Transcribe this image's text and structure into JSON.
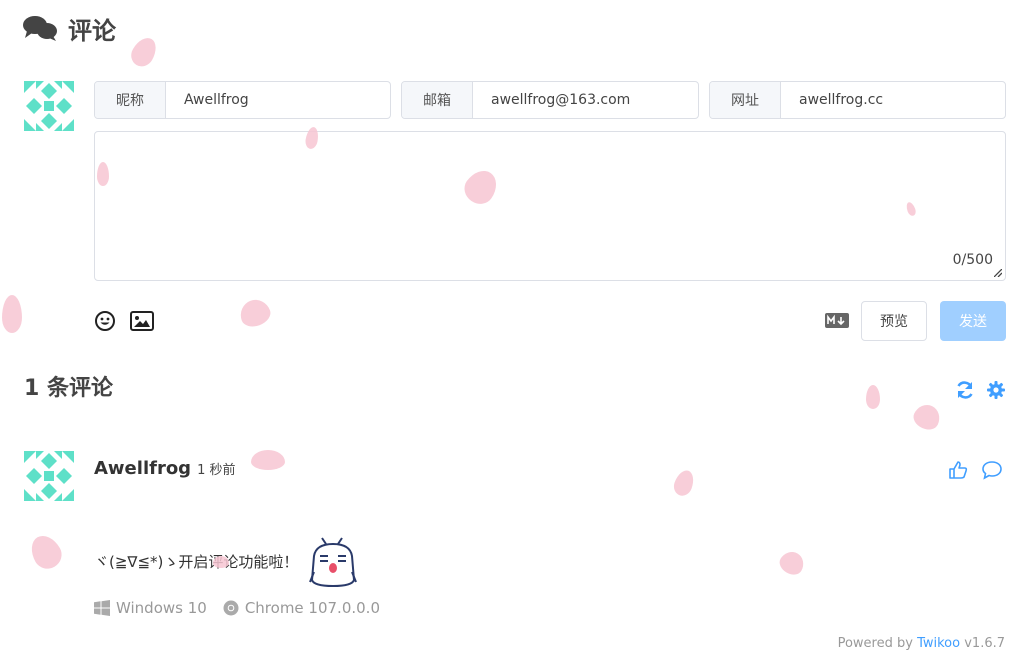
{
  "header": {
    "title": "评论",
    "icon": "comments-icon"
  },
  "form": {
    "nick_label": "昵称",
    "nick_value": "Awellfrog",
    "mail_label": "邮箱",
    "mail_value": "awellfrog@163.com",
    "link_label": "网址",
    "link_value": "awellfrog.cc",
    "textarea_value": "",
    "counter": "0/500",
    "preview_label": "预览",
    "send_label": "发送",
    "icons": [
      "emoji-icon",
      "image-icon",
      "markdown-icon"
    ]
  },
  "comments_section": {
    "count_title": "1 条评论",
    "icons": [
      "refresh-icon",
      "settings-icon"
    ]
  },
  "comments": [
    {
      "nick": "Awellfrog",
      "time": "1 秒前",
      "text": "ヾ(≧∇≦*)ゝ开启评论功能啦！",
      "os": "Windows 10",
      "browser": "Chrome 107.0.0.0"
    }
  ],
  "footer": {
    "prefix": "Powered by ",
    "brand": "Twikoo",
    "version": " v1.6.7"
  },
  "colors": {
    "accent": "#409eff",
    "send_disabled": "#a0cfff",
    "avatar": "#5ee0c8",
    "petal": "#f7c6d2"
  }
}
